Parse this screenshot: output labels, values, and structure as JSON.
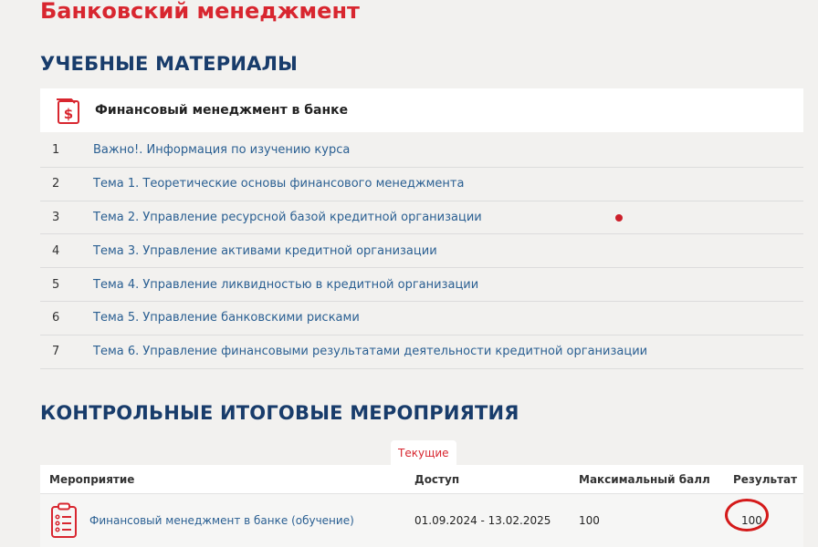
{
  "course": {
    "title": "Банковский менеджмент"
  },
  "materials": {
    "heading": "УЧЕБНЫЕ МАТЕРИАЛЫ",
    "card_title": "Финансовый менеджмент в банке",
    "card_icon": "document-dollar-icon",
    "topics": [
      {
        "num": "1",
        "label": "Важно!. Информация по изучению курса"
      },
      {
        "num": "2",
        "label": "Тема 1. Теоретические основы финансового менеджмента"
      },
      {
        "num": "3",
        "label": "Тема 2. Управление ресурсной базой кредитной организации"
      },
      {
        "num": "4",
        "label": "Тема 3. Управление активами кредитной организации"
      },
      {
        "num": "5",
        "label": "Тема 4. Управление ликвидностью в кредитной организации"
      },
      {
        "num": "6",
        "label": "Тема 5. Управление банковскими рисками"
      },
      {
        "num": "7",
        "label": "Тема 6. Управление финансовыми результатами деятельности кредитной организации"
      }
    ]
  },
  "control": {
    "heading": "КОНТРОЛЬНЫЕ ИТОГОВЫЕ МЕРОПРИЯТИЯ",
    "tab_label": "Текущие",
    "columns": {
      "event": "Мероприятие",
      "access": "Доступ",
      "max_score": "Максимальный балл",
      "result": "Результат"
    },
    "rows": [
      {
        "event": "Финансовый менеджмент в банке (обучение)",
        "access": "01.09.2024 - 13.02.2025",
        "max_score": "100",
        "result": "100",
        "icon": "clipboard-checklist-icon"
      }
    ]
  },
  "colors": {
    "accent_red": "#d8262f",
    "heading_blue": "#183c6b",
    "link_blue": "#2a5f92",
    "background": "#f2f1ef"
  }
}
